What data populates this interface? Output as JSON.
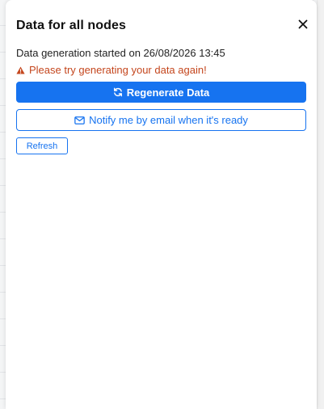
{
  "panel": {
    "title": "Data for all nodes",
    "status_text": "Data generation started on 26/08/2026 13:45",
    "error_text": "Please try generating your data again!"
  },
  "actions": {
    "regenerate_label": "Regenerate Data",
    "notify_label": "Notify me by email when it's ready",
    "refresh_label": "Refresh"
  },
  "colors": {
    "primary": "#1673f0",
    "error": "#c4461d"
  },
  "icons": {
    "close": "close-icon",
    "warning": "warning-icon",
    "refresh": "refresh-icon",
    "mail": "mail-icon"
  }
}
